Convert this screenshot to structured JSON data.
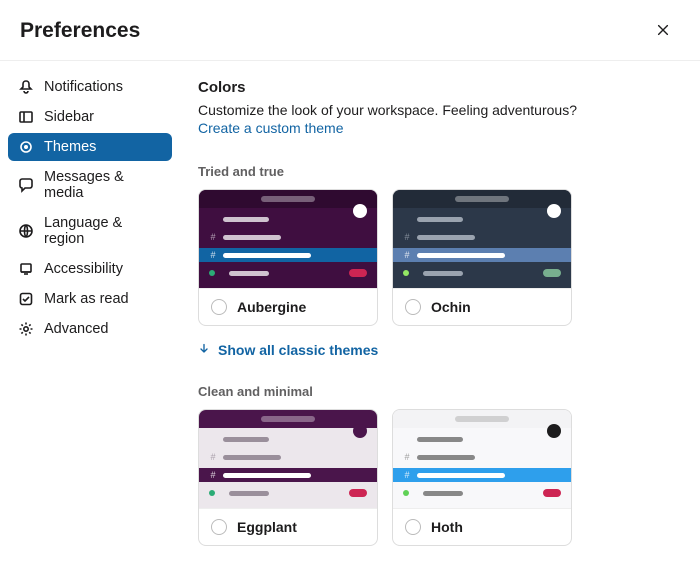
{
  "header": {
    "title": "Preferences"
  },
  "sidebar": {
    "items": [
      {
        "label": "Notifications"
      },
      {
        "label": "Sidebar"
      },
      {
        "label": "Themes",
        "active": true
      },
      {
        "label": "Messages & media"
      },
      {
        "label": "Language & region"
      },
      {
        "label": "Accessibility"
      },
      {
        "label": "Mark as read"
      },
      {
        "label": "Advanced"
      }
    ]
  },
  "content": {
    "section_title": "Colors",
    "section_desc": "Customize the look of your workspace. Feeling adventurous?",
    "custom_theme_link": "Create a custom theme",
    "groups": [
      {
        "label": "Tried and true",
        "show_all_label": "Show all classic themes",
        "themes": [
          {
            "name": "Aubergine",
            "colors": {
              "bg": "#3f0e40",
              "topbar": "#2f0a30",
              "search": "#ffffff",
              "text": "#cfc3cf",
              "highlight_bg": "#1164a3",
              "highlight_text": "#ffffff",
              "presence": "#2bac76",
              "badge": "#cd2553",
              "dot": "#ffffff"
            }
          },
          {
            "name": "Ochin",
            "colors": {
              "bg": "#2c3849",
              "topbar": "#222b38",
              "search": "#ffffff",
              "text": "#9aa3af",
              "highlight_bg": "#5c7fb0",
              "highlight_text": "#ffffff",
              "presence": "#94e864",
              "badge": "#78af8f",
              "dot": "#ffffff"
            }
          }
        ]
      },
      {
        "label": "Clean and minimal",
        "themes": [
          {
            "name": "Eggplant",
            "colors": {
              "bg": "#ece7ec",
              "topbar": "#4a154b",
              "search": "#ffffff",
              "text": "#9a8f9b",
              "highlight_bg": "#4a154b",
              "highlight_text": "#ffffff",
              "presence": "#2bac76",
              "badge": "#cd2553",
              "dot": "#4a154b"
            }
          },
          {
            "name": "Hoth",
            "colors": {
              "bg": "#f8f8fa",
              "topbar": "#f3f3f5",
              "search": "#8f8f8f",
              "text": "#888888",
              "highlight_bg": "#2e9fec",
              "highlight_text": "#ffffff",
              "presence": "#60d156",
              "badge": "#cd2553",
              "dot": "#1d1c1d"
            }
          }
        ]
      }
    ]
  }
}
